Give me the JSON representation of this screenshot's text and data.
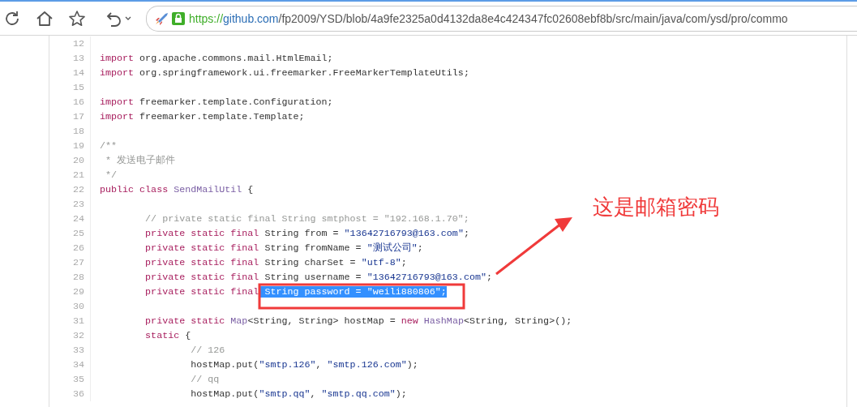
{
  "toolbar": {
    "url": {
      "scheme": "https://",
      "host": "github.com",
      "path": "/fp2009/YSD/blob/4a9fe2325a0d4132da8e4c424347fc02608ebf8b/src/main/java/com/ysd/pro/commo"
    }
  },
  "code": {
    "lines": [
      {
        "number": "12"
      },
      {
        "number": "13",
        "tokens": [
          {
            "kind": "keyword",
            "text": "import"
          },
          {
            "kind": "plain",
            "text": " org.apache.commons.mail.HtmlEmail;"
          }
        ]
      },
      {
        "number": "14",
        "tokens": [
          {
            "kind": "keyword",
            "text": "import"
          },
          {
            "kind": "plain",
            "text": " org.springframework.ui.freemarker.FreeMarkerTemplateUtils;"
          }
        ]
      },
      {
        "number": "15"
      },
      {
        "number": "16",
        "tokens": [
          {
            "kind": "keyword",
            "text": "import"
          },
          {
            "kind": "plain",
            "text": " freemarker.template.Configuration;"
          }
        ]
      },
      {
        "number": "17",
        "tokens": [
          {
            "kind": "keyword",
            "text": "import"
          },
          {
            "kind": "plain",
            "text": " freemarker.template.Template;"
          }
        ]
      },
      {
        "number": "18"
      },
      {
        "number": "19",
        "tokens": [
          {
            "kind": "comment",
            "text": "/**"
          }
        ]
      },
      {
        "number": "20",
        "tokens": [
          {
            "kind": "comment",
            "text": " * 发送电子邮件"
          }
        ]
      },
      {
        "number": "21",
        "tokens": [
          {
            "kind": "comment",
            "text": " */"
          }
        ]
      },
      {
        "number": "22",
        "tokens": [
          {
            "kind": "keyword",
            "text": "public class "
          },
          {
            "kind": "type",
            "text": "SendMailUtil"
          },
          {
            "kind": "plain",
            "text": " {"
          }
        ]
      },
      {
        "number": "23"
      },
      {
        "number": "24",
        "tokens": [
          {
            "kind": "comment",
            "text": "        // private static final String smtphost = \"192.168.1.70\";"
          }
        ]
      },
      {
        "number": "25",
        "tokens": [
          {
            "kind": "keyword",
            "text": "        private static final"
          },
          {
            "kind": "plain",
            "text": " String from = "
          },
          {
            "kind": "string",
            "text": "\"13642716793@163.com\""
          },
          {
            "kind": "plain",
            "text": ";"
          }
        ]
      },
      {
        "number": "26",
        "tokens": [
          {
            "kind": "keyword",
            "text": "        private static final"
          },
          {
            "kind": "plain",
            "text": " String fromName = "
          },
          {
            "kind": "string",
            "text": "\"测试公司\""
          },
          {
            "kind": "plain",
            "text": ";"
          }
        ]
      },
      {
        "number": "27",
        "tokens": [
          {
            "kind": "keyword",
            "text": "        private static final"
          },
          {
            "kind": "plain",
            "text": " String charSet = "
          },
          {
            "kind": "string",
            "text": "\"utf-8\""
          },
          {
            "kind": "plain",
            "text": ";"
          }
        ]
      },
      {
        "number": "28",
        "tokens": [
          {
            "kind": "keyword",
            "text": "        private static final"
          },
          {
            "kind": "plain",
            "text": " String username = "
          },
          {
            "kind": "string",
            "text": "\"13642716793@163.com\""
          },
          {
            "kind": "plain",
            "text": ";"
          }
        ]
      },
      {
        "number": "29",
        "tokens": [
          {
            "kind": "keyword",
            "text": "        private static final"
          },
          {
            "kind": "selection",
            "text": " String password = \"weili880806\";"
          }
        ]
      },
      {
        "number": "30"
      },
      {
        "number": "31",
        "tokens": [
          {
            "kind": "keyword",
            "text": "        private static "
          },
          {
            "kind": "type",
            "text": "Map"
          },
          {
            "kind": "plain",
            "text": "<String, String> hostMap = "
          },
          {
            "kind": "keyword",
            "text": "new "
          },
          {
            "kind": "type",
            "text": "HashMap"
          },
          {
            "kind": "plain",
            "text": "<String, String>();"
          }
        ]
      },
      {
        "number": "32",
        "tokens": [
          {
            "kind": "keyword",
            "text": "        static"
          },
          {
            "kind": "plain",
            "text": " {"
          }
        ]
      },
      {
        "number": "33",
        "tokens": [
          {
            "kind": "comment",
            "text": "                // 126"
          }
        ]
      },
      {
        "number": "34",
        "tokens": [
          {
            "kind": "plain",
            "text": "                hostMap.put("
          },
          {
            "kind": "string",
            "text": "\"smtp.126\""
          },
          {
            "kind": "plain",
            "text": ", "
          },
          {
            "kind": "string",
            "text": "\"smtp.126.com\""
          },
          {
            "kind": "plain",
            "text": ");"
          }
        ]
      },
      {
        "number": "35",
        "tokens": [
          {
            "kind": "comment",
            "text": "                // qq"
          }
        ]
      },
      {
        "number": "36",
        "tokens": [
          {
            "kind": "plain",
            "text": "                hostMap.put("
          },
          {
            "kind": "string",
            "text": "\"smtp.qq\""
          },
          {
            "kind": "plain",
            "text": ", "
          },
          {
            "kind": "string",
            "text": "\"smtp.qq.com\""
          },
          {
            "kind": "plain",
            "text": ");"
          }
        ]
      }
    ]
  },
  "annotation": {
    "text": "这是邮箱密码"
  }
}
